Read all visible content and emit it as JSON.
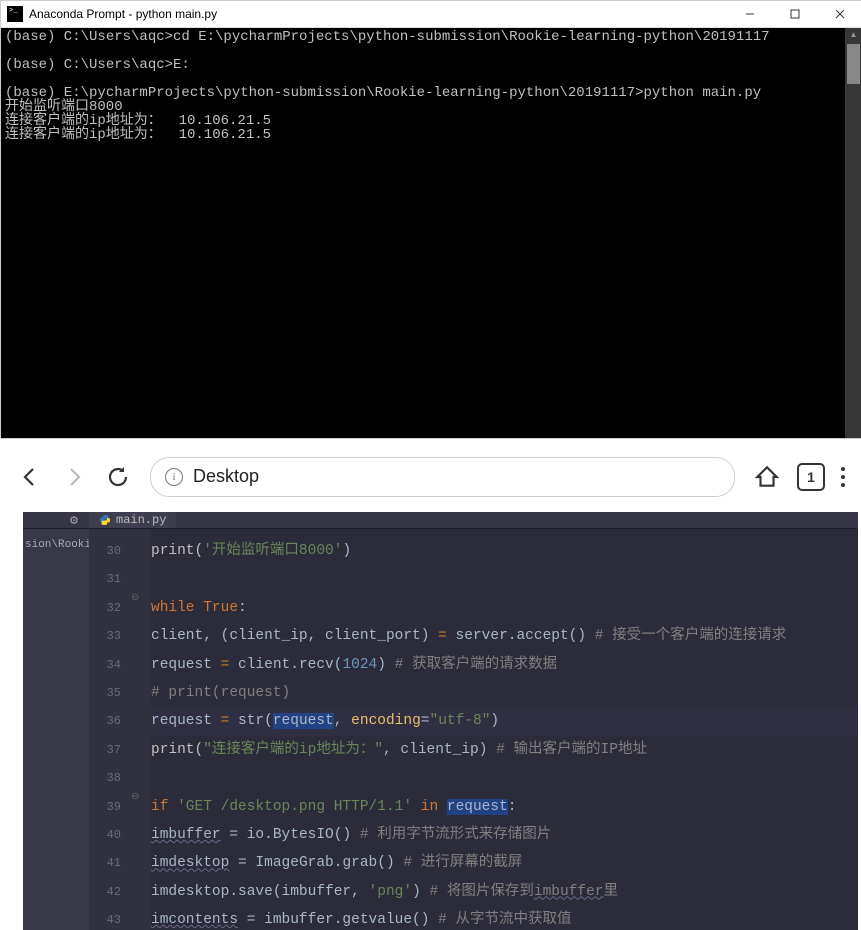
{
  "terminal": {
    "title": "Anaconda Prompt - python  main.py",
    "output": "(base) C:\\Users\\aqc>cd E:\\pycharmProjects\\python-submission\\Rookie-learning-python\\20191117\n\n(base) C:\\Users\\aqc>E:\n\n(base) E:\\pycharmProjects\\python-submission\\Rookie-learning-python\\20191117>python main.py\n开始监听端口8000\n连接客户端的ip地址为：  10.106.21.5\n连接客户端的ip地址为：  10.106.21.5\n"
  },
  "browser": {
    "url_text": "Desktop",
    "tab_count": "1"
  },
  "editor": {
    "filename": "main.py",
    "project_fragment": "sion\\Rookie",
    "gutter": [
      "30",
      "31",
      "32",
      "33",
      "34",
      "35",
      "36",
      "37",
      "38",
      "39",
      "40",
      "41",
      "42",
      "43"
    ],
    "code": {
      "l30_a": "print(",
      "l30_s": "'开始监听端口8000'",
      "l30_c": ")",
      "l32_a": "while ",
      "l32_b": "True",
      "l32_c": ":",
      "l33_a": "client, (client_ip, client_port) ",
      "l33_b": "=",
      "l33_c": " server.accept()   ",
      "l33_d": "# 接受一个客户端的连接请求",
      "l34_a": "request ",
      "l34_b": "=",
      "l34_c": " client.recv(",
      "l34_d": "1024",
      "l34_e": ")   ",
      "l34_f": "# 获取客户端的请求数据",
      "l35_a": "# print(request)",
      "l36_a": "request ",
      "l36_b": "=",
      "l36_c": " str(",
      "l36_d": "request",
      "l36_e": ", ",
      "l36_f": "encoding",
      "l36_g": "=",
      "l36_h": "\"utf-8\"",
      "l36_i": ")",
      "l37_a": "print(",
      "l37_b": "\"连接客户端的ip地址为：\"",
      "l37_c": ", client_ip)   ",
      "l37_d": "# 输出客户端的IP地址",
      "l39_a": "if ",
      "l39_b": "'GET /desktop.png HTTP/1.1'",
      "l39_c": " in ",
      "l39_d": "request",
      "l39_e": ":",
      "l40_a": "imbuffer",
      "l40_b": " = io.BytesIO()   ",
      "l40_c": "# 利用字节流形式来存储图片",
      "l41_a": "imdesktop",
      "l41_b": " = ImageGrab.grab()   ",
      "l41_c": "# 进行屏幕的截屏",
      "l42_a": "imdesktop.save(imbuffer, ",
      "l42_b": "'png'",
      "l42_c": ")   ",
      "l42_d": "# 将图片保存到",
      "l42_e": "imbuffer",
      "l42_f": "里",
      "l43_a": "imcontents",
      "l43_b": " = imbuffer.getvalue()   ",
      "l43_c": "# 从字节流中获取值"
    }
  }
}
